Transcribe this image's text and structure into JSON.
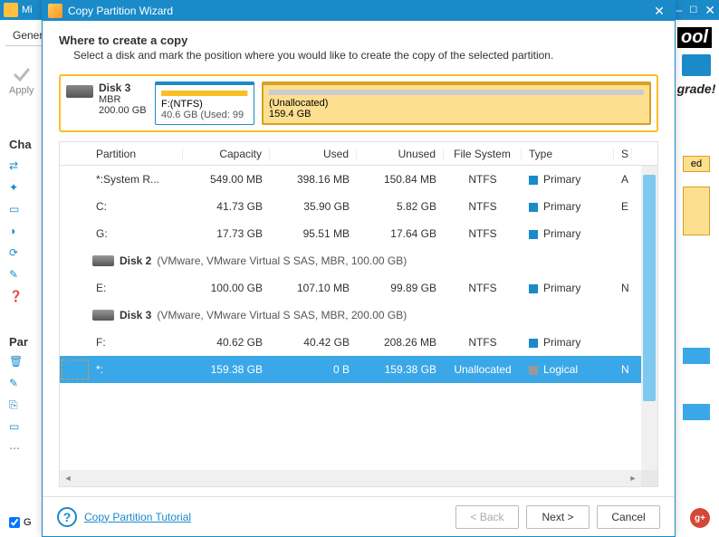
{
  "bg": {
    "parentTitle": "Mi",
    "tab": "Gener",
    "apply": "Apply",
    "section1": "Cha",
    "section2": "Par",
    "tool": "ool",
    "upgrade": "grade!",
    "ed": "ed",
    "bottomG": "G"
  },
  "dialog": {
    "title": "Copy Partition Wizard",
    "heading": "Where to create a copy",
    "subheading": "Select a disk and mark the position where you would like to create the copy of the selected partition."
  },
  "disk": {
    "name": "Disk 3",
    "scheme": "MBR",
    "size": "200.00 GB",
    "partF": {
      "label": "F:(NTFS)",
      "detail": "40.6 GB (Used: 99",
      "usedPct": 99
    },
    "unalloc": {
      "label": "(Unallocated)",
      "size": "159.4 GB"
    }
  },
  "columns": {
    "partition": "Partition",
    "capacity": "Capacity",
    "used": "Used",
    "unused": "Unused",
    "fs": "File System",
    "type": "Type",
    "status": "S"
  },
  "groups": {
    "disk2": "Disk 2",
    "disk2detail": "(VMware, VMware Virtual S SAS, MBR, 100.00 GB)",
    "disk3": "Disk 3",
    "disk3detail": "(VMware, VMware Virtual S SAS, MBR, 200.00 GB)"
  },
  "rows": [
    {
      "part": "*:System R...",
      "cap": "549.00 MB",
      "used": "398.16 MB",
      "unused": "150.84 MB",
      "fs": "NTFS",
      "type": "Primary",
      "typeColor": "blue",
      "status": "A"
    },
    {
      "part": "C:",
      "cap": "41.73 GB",
      "used": "35.90 GB",
      "unused": "5.82 GB",
      "fs": "NTFS",
      "type": "Primary",
      "typeColor": "blue",
      "status": "E"
    },
    {
      "part": "G:",
      "cap": "17.73 GB",
      "used": "95.51 MB",
      "unused": "17.64 GB",
      "fs": "NTFS",
      "type": "Primary",
      "typeColor": "blue",
      "status": ""
    },
    {
      "part": "E:",
      "cap": "100.00 GB",
      "used": "107.10 MB",
      "unused": "99.89 GB",
      "fs": "NTFS",
      "type": "Primary",
      "typeColor": "blue",
      "status": "N"
    },
    {
      "part": "F:",
      "cap": "40.62 GB",
      "used": "40.42 GB",
      "unused": "208.26 MB",
      "fs": "NTFS",
      "type": "Primary",
      "typeColor": "blue",
      "status": ""
    },
    {
      "part": "*:",
      "cap": "159.38 GB",
      "used": "0 B",
      "unused": "159.38 GB",
      "fs": "Unallocated",
      "type": "Logical",
      "typeColor": "gray",
      "status": "N",
      "selected": true
    }
  ],
  "footer": {
    "tutorial": "Copy Partition Tutorial",
    "back": "< Back",
    "next": "Next >",
    "cancel": "Cancel"
  }
}
